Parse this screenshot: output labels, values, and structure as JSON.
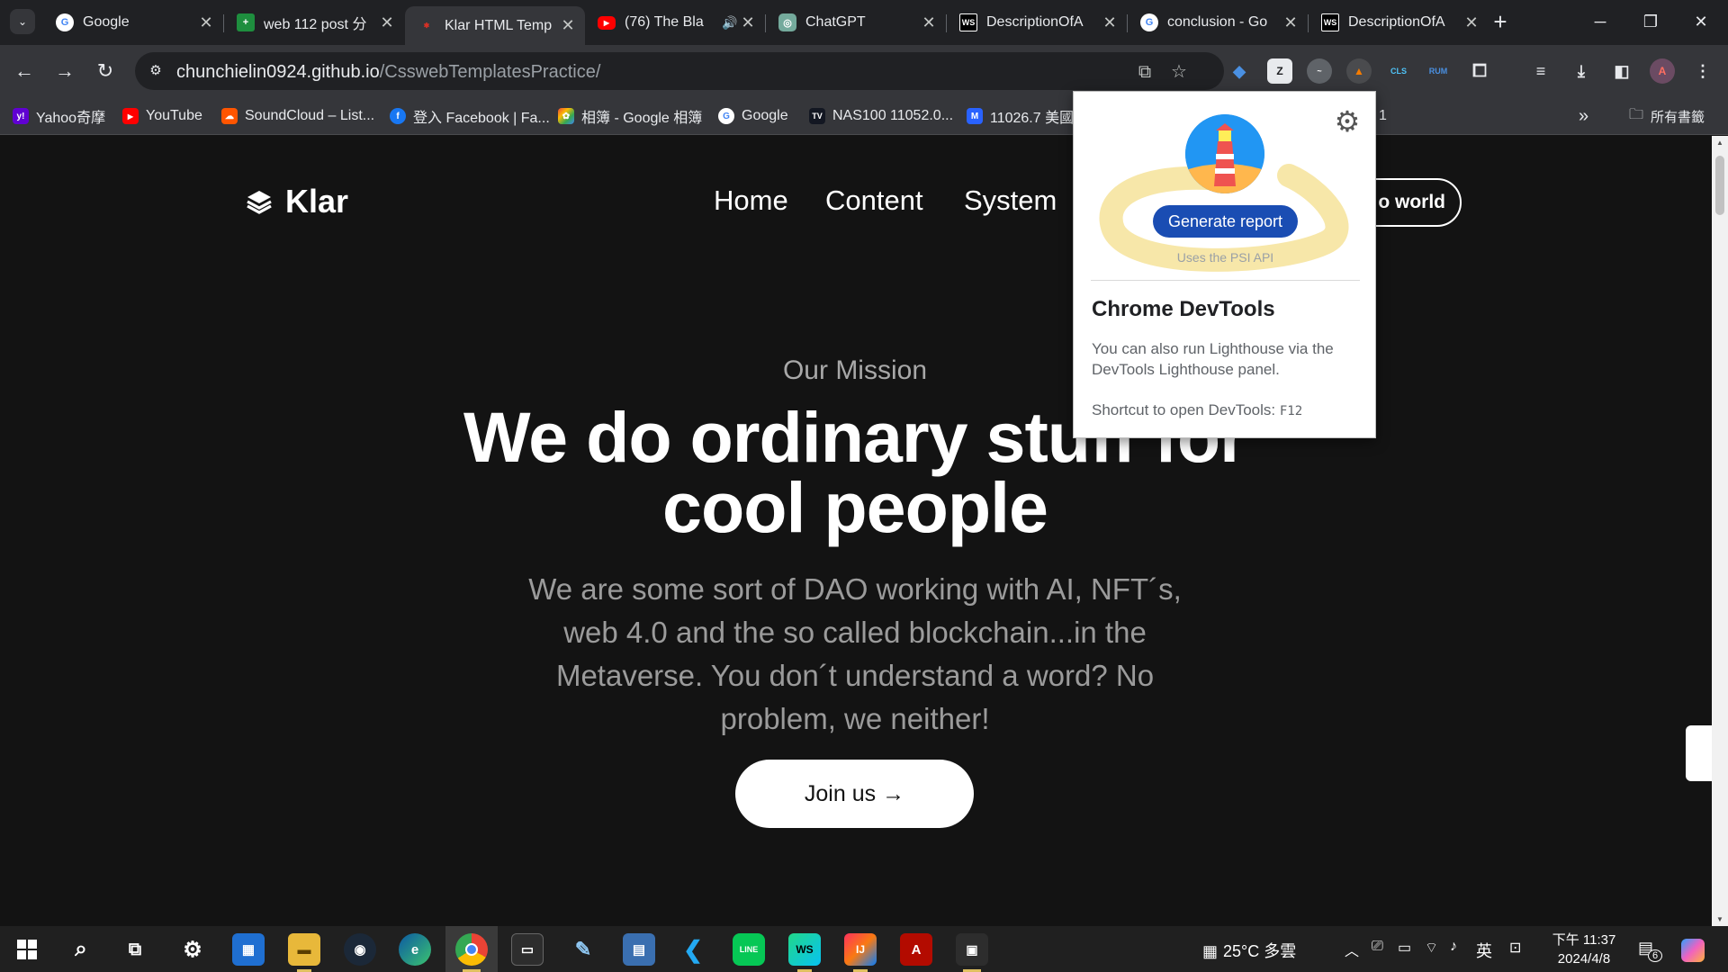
{
  "browser": {
    "tabs": [
      {
        "title": "Google",
        "icon": "google-icon",
        "color": "#ffffff"
      },
      {
        "title": "web 112 post 分",
        "icon": "sheets-icon",
        "color": "#1e8e3e"
      },
      {
        "title": "Klar HTML Temp",
        "icon": "klar-icon",
        "color": "#d93025"
      },
      {
        "title": "(76) The Bla",
        "icon": "youtube-icon",
        "color": "#ff0000"
      },
      {
        "title": "ChatGPT",
        "icon": "chatgpt-icon",
        "color": "#74aa9c"
      },
      {
        "title": "DescriptionOfA",
        "icon": "webstorm-icon",
        "color": "#000000"
      },
      {
        "title": "conclusion - Go",
        "icon": "google-icon",
        "color": "#ffffff"
      },
      {
        "title": "DescriptionOfA",
        "icon": "webstorm-icon",
        "color": "#000000"
      }
    ],
    "active_tab_index": 2,
    "close_glyph": "✕",
    "new_tab_glyph": "+",
    "address": {
      "host": "chunchielin0924.github.io",
      "path": "/CsswebTemplatesPractice/"
    },
    "bookmarks": [
      {
        "label": "Yahoo奇摩",
        "icon": "yahoo-icon",
        "color": "#6001d2"
      },
      {
        "label": "YouTube",
        "icon": "youtube-icon",
        "color": "#ff0000"
      },
      {
        "label": "SoundCloud – List...",
        "icon": "soundcloud-icon",
        "color": "#ff5500"
      },
      {
        "label": "登入 Facebook | Fa...",
        "icon": "facebook-icon",
        "color": "#1877f2"
      },
      {
        "label": "相簿 - Google 相簿",
        "icon": "photos-icon",
        "color": "#fbbc04"
      },
      {
        "label": "Google",
        "icon": "google-icon",
        "color": "#ffffff"
      },
      {
        "label": "NAS100 11052.0...",
        "icon": "tradingview-icon",
        "color": "#131722"
      },
      {
        "label": "11026.7 美國",
        "icon": "chart-icon",
        "color": "#2962ff"
      },
      {
        "label": "1",
        "icon": "",
        "color": ""
      }
    ],
    "bookmarks_overflow": "»",
    "all_bookmarks": "所有書籤"
  },
  "site": {
    "logo_text": "Klar",
    "nav": [
      "Home",
      "Content",
      "System"
    ],
    "header_button": "o world",
    "eyebrow": "Our Mission",
    "headline_line1": "We do ordinary stuff for",
    "headline_line2": "cool people",
    "subtext": "We are some sort of DAO working with AI, NFT´s, web 4.0 and the so called blockchain...in the Metaverse. You don´t understand a word? No problem, we neither!",
    "cta": "Join us →"
  },
  "popup": {
    "generate_button": "Generate report",
    "psi_note": "Uses the PSI API",
    "title": "Chrome DevTools",
    "description": "You can also run Lighthouse via the DevTools Lighthouse panel.",
    "shortcut_label": "Shortcut to open DevTools:",
    "shortcut_key": "F12",
    "accent": "#1a4db3"
  },
  "taskbar": {
    "weather": "25°C 多雲",
    "ime": "英",
    "time": "下午 11:37",
    "date": "2024/4/8",
    "notification_count": "6",
    "apps": [
      "start-icon",
      "search-icon",
      "task-view-icon",
      "settings-icon",
      "store-icon",
      "file-explorer-icon",
      "steam-icon",
      "edge-icon",
      "chrome-icon",
      "terminal-icon",
      "pen-icon",
      "calculator-icon",
      "vscode-icon",
      "line-icon",
      "webstorm-icon",
      "intellij-icon",
      "acrobat-icon",
      "app-icon"
    ]
  }
}
